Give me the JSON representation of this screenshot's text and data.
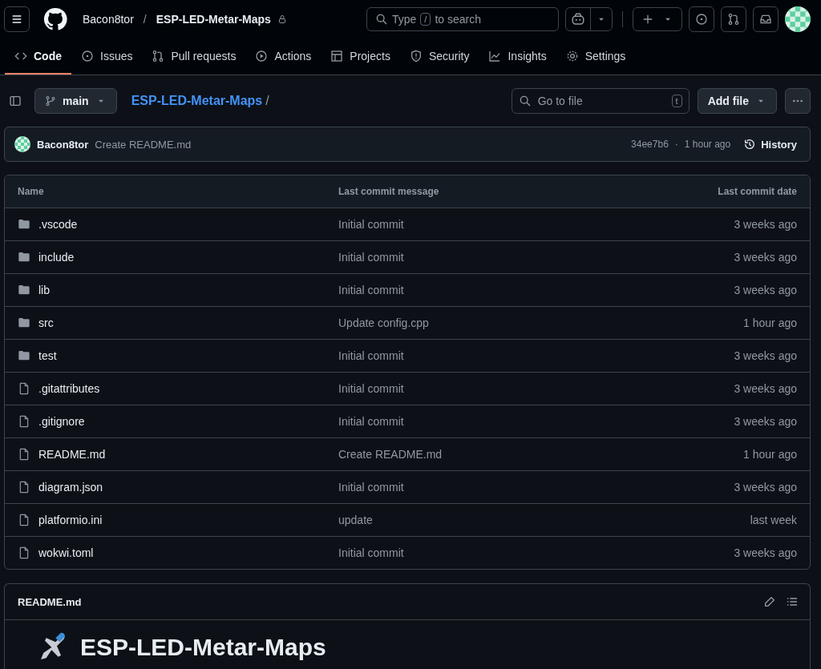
{
  "header": {
    "owner": "Bacon8tor",
    "separator": "/",
    "repo": "ESP-LED-Metar-Maps",
    "private": true,
    "search": {
      "placeholder_before": "Type",
      "key": "/",
      "placeholder_after": "to search"
    }
  },
  "tabs": [
    {
      "label": "Code",
      "kind": "code",
      "selected": true
    },
    {
      "label": "Issues",
      "kind": "issue",
      "selected": false
    },
    {
      "label": "Pull requests",
      "kind": "pr",
      "selected": false
    },
    {
      "label": "Actions",
      "kind": "play",
      "selected": false
    },
    {
      "label": "Projects",
      "kind": "table",
      "selected": false
    },
    {
      "label": "Security",
      "kind": "shield",
      "selected": false
    },
    {
      "label": "Insights",
      "kind": "graph",
      "selected": false
    },
    {
      "label": "Settings",
      "kind": "gear",
      "selected": false
    }
  ],
  "toolbar": {
    "branch": "main",
    "path": "ESP-LED-Metar-Maps",
    "path_separator": "/",
    "go_to_file": {
      "placeholder": "Go to file",
      "key": "t"
    },
    "add_file": "Add file"
  },
  "latest_commit": {
    "author": "Bacon8tor",
    "message": "Create README.md",
    "sha": "34ee7b6",
    "separator": "·",
    "time": "1 hour ago",
    "history": "History"
  },
  "table": {
    "columns": [
      "Name",
      "Last commit message",
      "Last commit date"
    ],
    "rows": [
      {
        "kind": "dir",
        "name": ".vscode",
        "message": "Initial commit",
        "date": "3 weeks ago"
      },
      {
        "kind": "dir",
        "name": "include",
        "message": "Initial commit",
        "date": "3 weeks ago"
      },
      {
        "kind": "dir",
        "name": "lib",
        "message": "Initial commit",
        "date": "3 weeks ago"
      },
      {
        "kind": "dir",
        "name": "src",
        "message": "Update config.cpp",
        "date": "1 hour ago"
      },
      {
        "kind": "dir",
        "name": "test",
        "message": "Initial commit",
        "date": "3 weeks ago"
      },
      {
        "kind": "file",
        "name": ".gitattributes",
        "message": "Initial commit",
        "date": "3 weeks ago"
      },
      {
        "kind": "file",
        "name": ".gitignore",
        "message": "Initial commit",
        "date": "3 weeks ago"
      },
      {
        "kind": "file",
        "name": "README.md",
        "message": "Create README.md",
        "date": "1 hour ago"
      },
      {
        "kind": "file",
        "name": "diagram.json",
        "message": "Initial commit",
        "date": "3 weeks ago"
      },
      {
        "kind": "file",
        "name": "platformio.ini",
        "message": "update",
        "date": "last week"
      },
      {
        "kind": "file",
        "name": "wokwi.toml",
        "message": "Initial commit",
        "date": "3 weeks ago"
      }
    ]
  },
  "readme": {
    "filename": "README.md",
    "heading": "ESP-LED-Metar-Maps"
  }
}
